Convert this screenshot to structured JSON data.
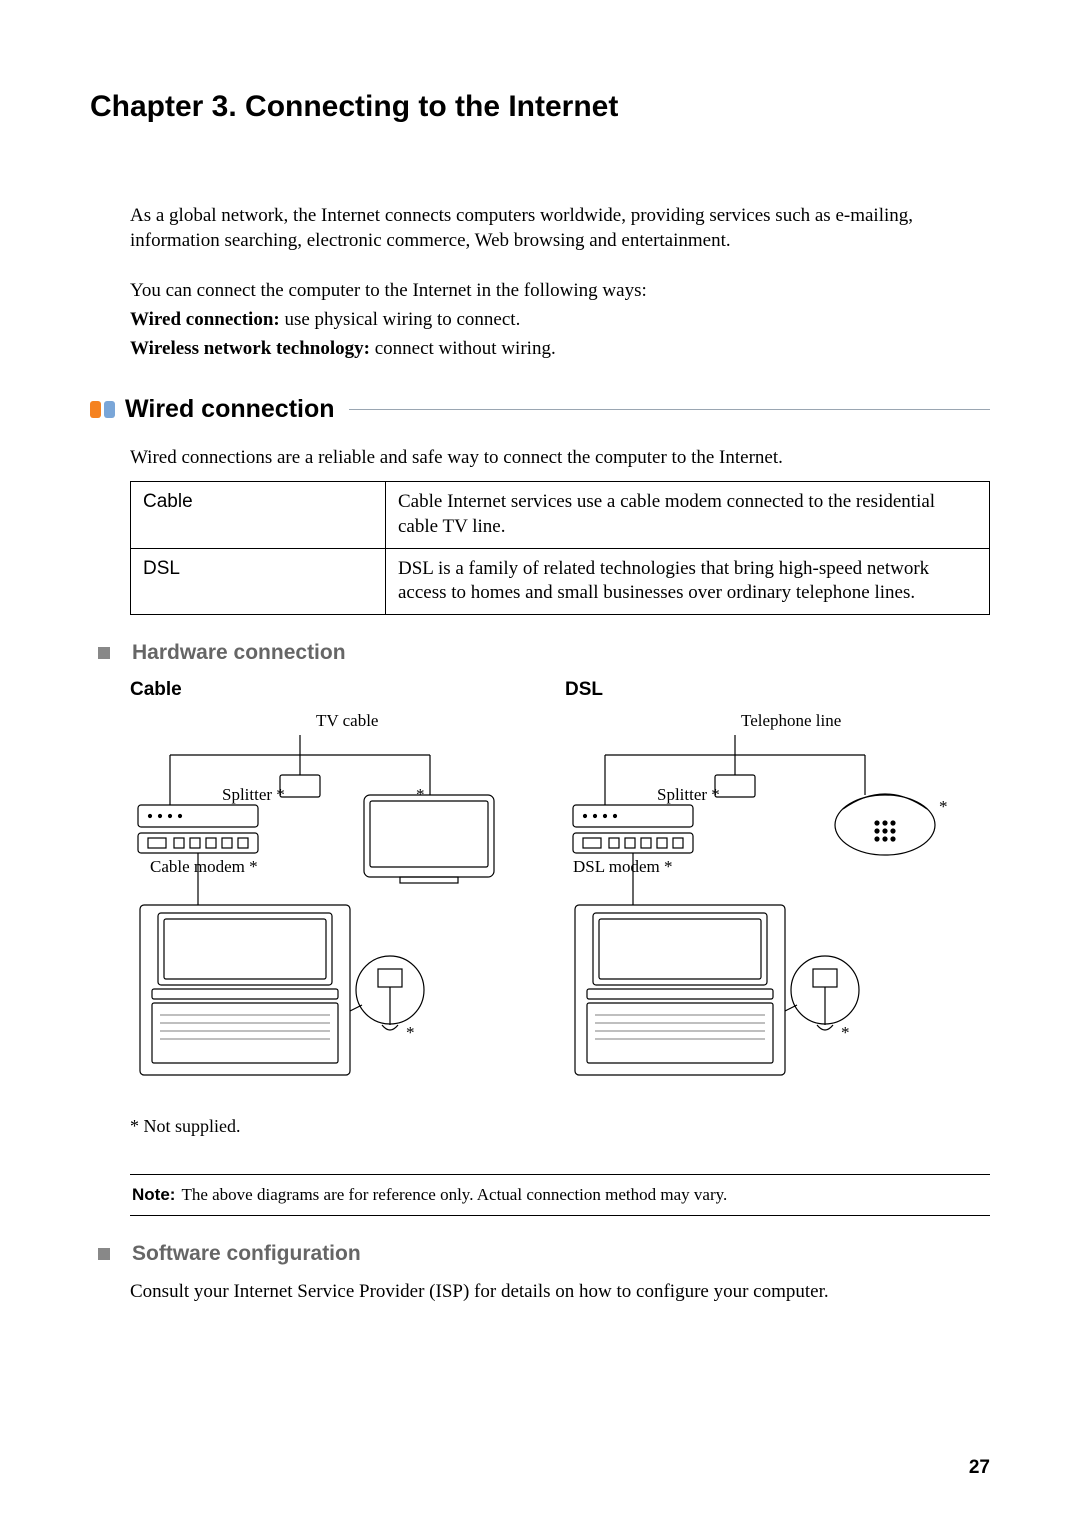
{
  "chapter_title": "Chapter 3. Connecting to the Internet",
  "intro": {
    "p1": "As a global network, the Internet connects computers worldwide, providing services such as e-mailing, information searching, electronic commerce, Web browsing and entertainment.",
    "p2": "You can connect the computer to the Internet in the following ways:",
    "wired_label": "Wired connection:",
    "wired_text": " use physical wiring to connect.",
    "wireless_label": "Wireless network technology:",
    "wireless_text": " connect without wiring."
  },
  "section1": {
    "title": "Wired connection",
    "p1": "Wired connections are a reliable and safe way to connect the computer to the Internet.",
    "table": {
      "rows": [
        {
          "term": "Cable",
          "desc": "Cable Internet services use a cable modem connected to the residential cable TV line."
        },
        {
          "term": "DSL",
          "desc": "DSL is a family of related technologies that bring high-speed network access to homes and small businesses over ordinary telephone lines."
        }
      ]
    },
    "sub_hardware": "Hardware connection",
    "diagram": {
      "cable_title": "Cable",
      "dsl_title": "DSL",
      "tv_cable": "TV cable",
      "telephone_line": "Telephone line",
      "splitter": "Splitter *",
      "star": "*",
      "cable_modem": "Cable modem *",
      "dsl_modem": "DSL modem *"
    },
    "footnote": "* Not supplied.",
    "note_label": "Note:",
    "note_text": "The above diagrams are for reference only. Actual connection method may vary.",
    "sub_software": "Software configuration",
    "software_p": "Consult your Internet Service Provider (ISP) for details on how to configure your computer."
  },
  "page_number": "27"
}
